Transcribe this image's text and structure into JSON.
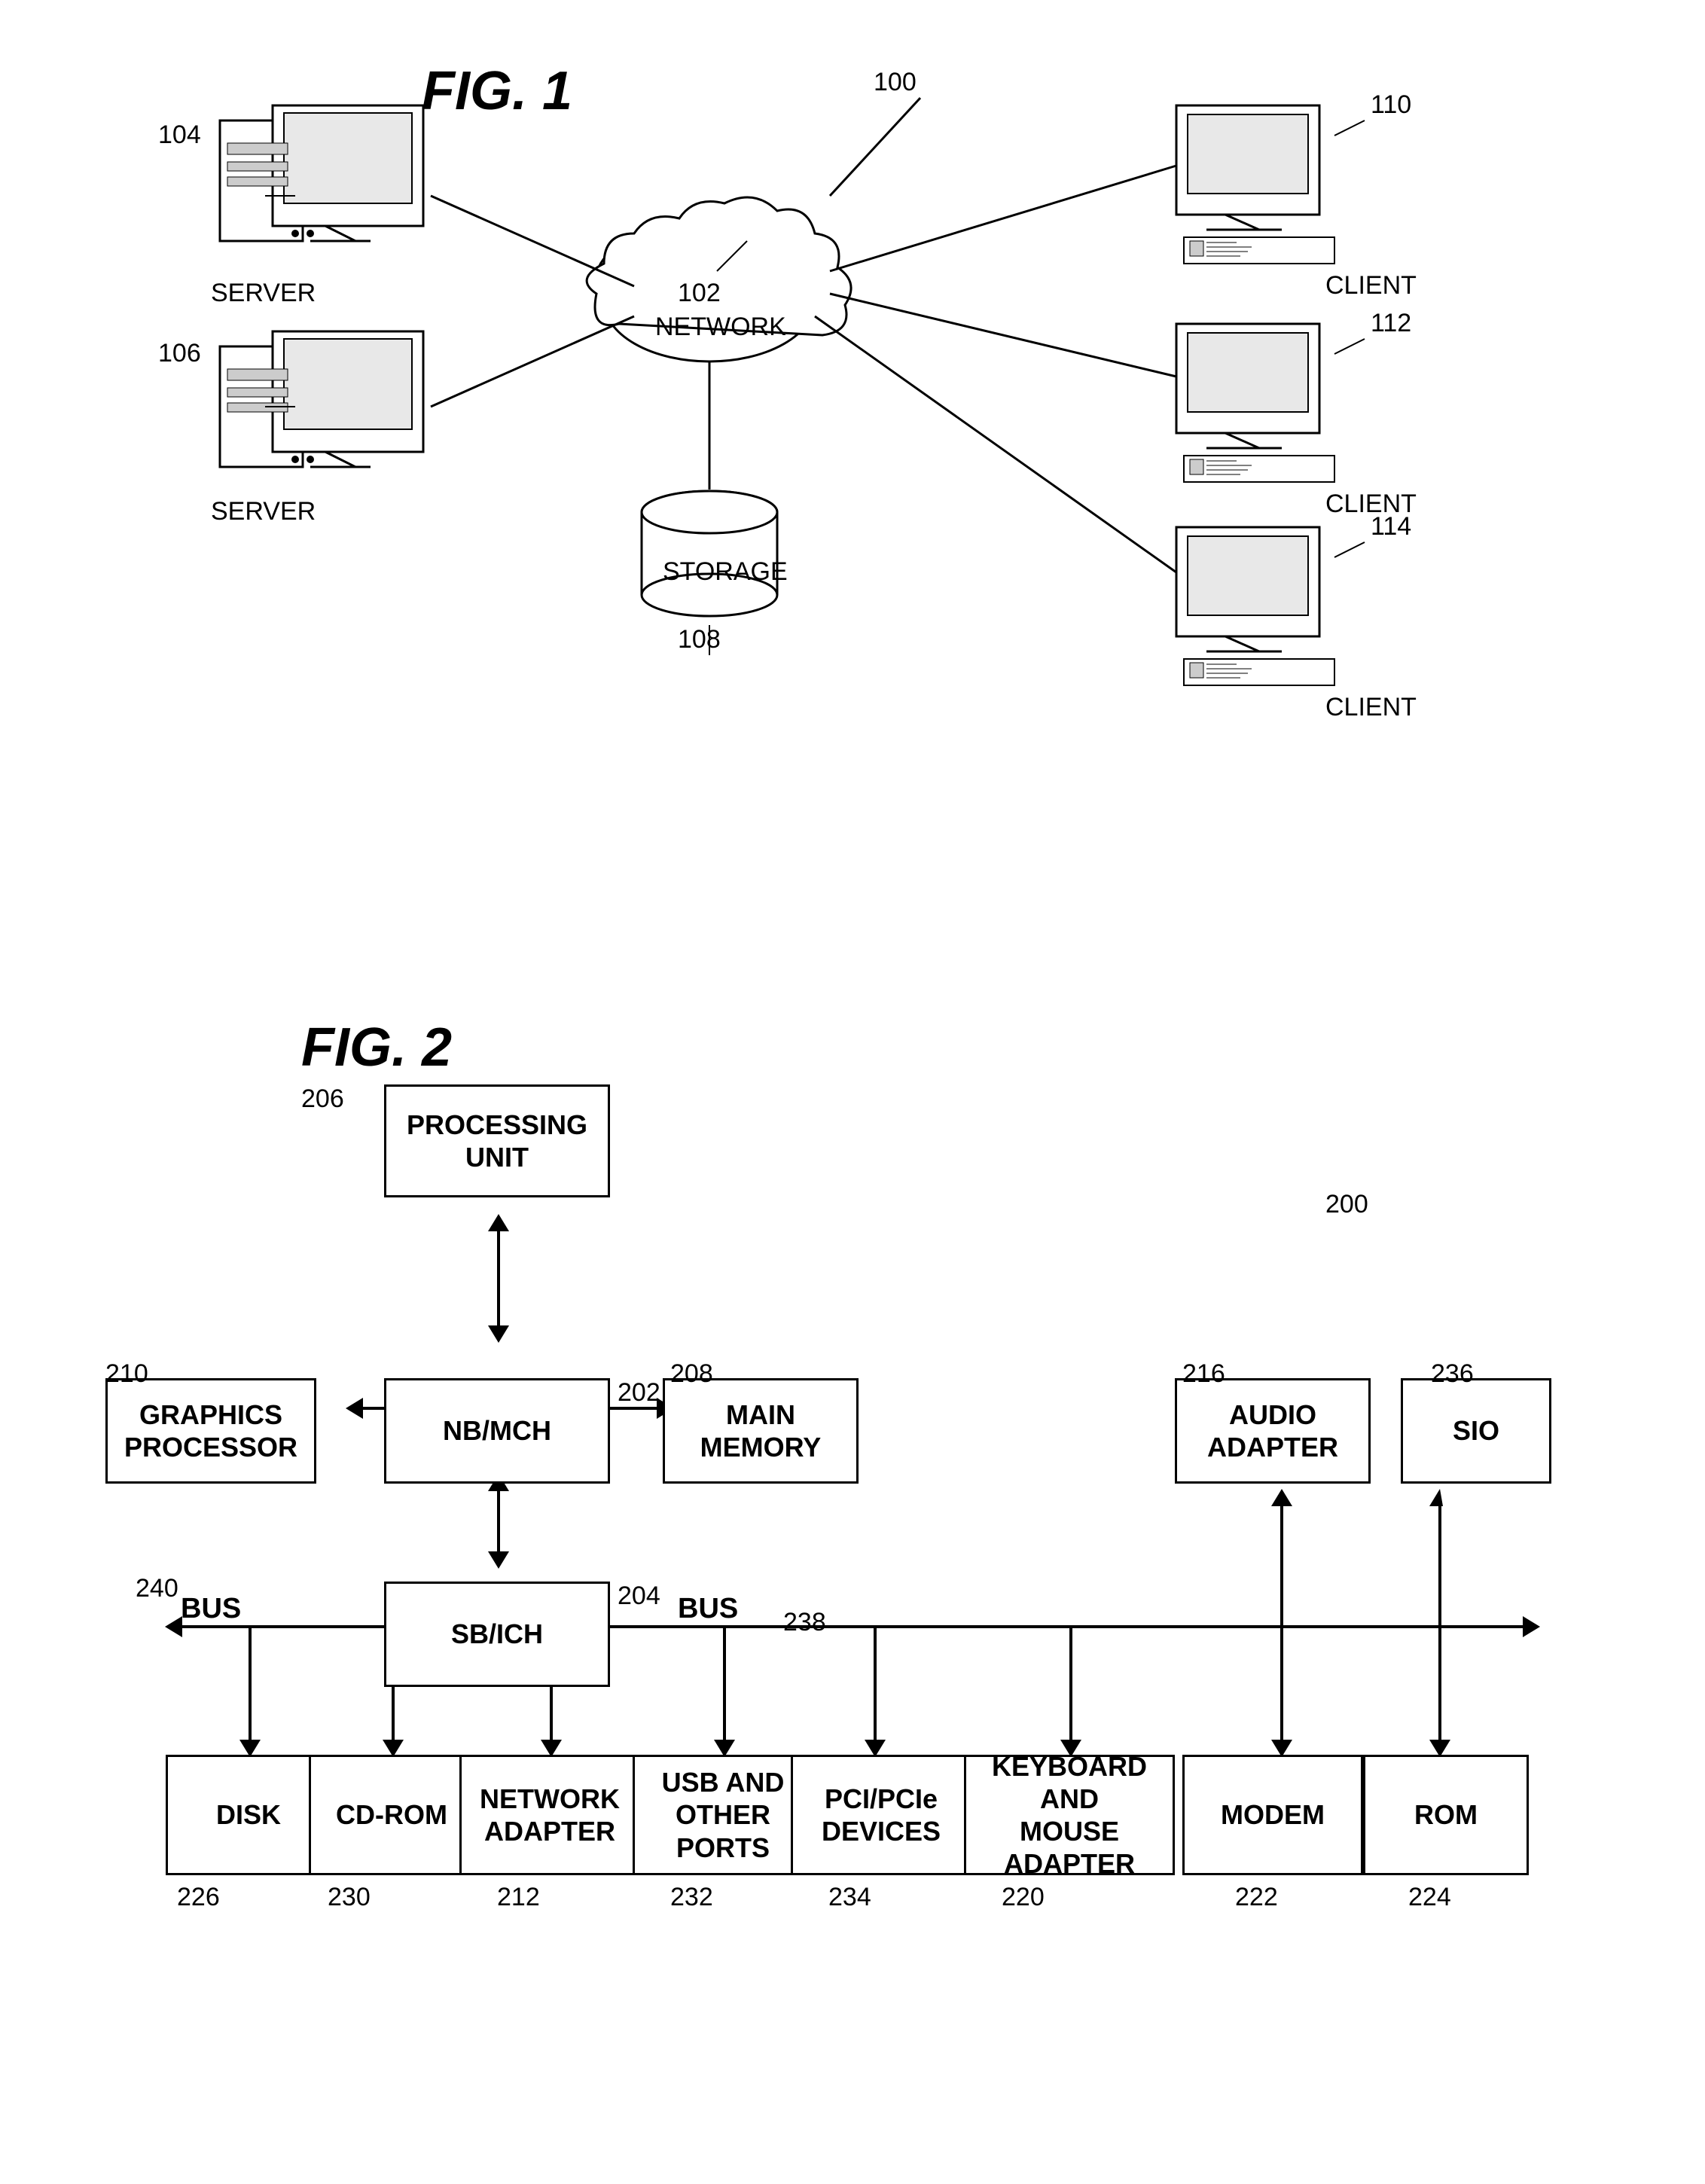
{
  "fig1": {
    "title": "FIG. 1",
    "ref_main": "100",
    "ref_network": "102",
    "ref_server1": "104",
    "ref_server2": "106",
    "ref_storage": "108",
    "ref_client1": "110",
    "ref_client2": "112",
    "ref_client3": "114",
    "label_server": "SERVER",
    "label_network": "NETWORK",
    "label_storage": "STORAGE",
    "label_client": "CLIENT"
  },
  "fig2": {
    "title": "FIG. 2",
    "ref_main": "200",
    "ref_nb_mch": "202",
    "ref_sb_ich": "204",
    "ref_processing_unit": "206",
    "ref_main_memory": "208",
    "ref_graphics": "210",
    "ref_network_adapter": "212",
    "ref_audio": "216",
    "ref_keyboard": "220",
    "ref_modem": "222",
    "ref_rom": "224",
    "ref_disk": "226",
    "ref_cd_rom": "230",
    "ref_usb": "232",
    "ref_pci": "234",
    "ref_sio": "236",
    "ref_bus1": "238",
    "ref_bus2": "240",
    "label_processing_unit": "PROCESSING\nUNIT",
    "label_nb_mch": "NB/MCH",
    "label_sb_ich": "SB/ICH",
    "label_main_memory": "MAIN\nMEMORY",
    "label_graphics": "GRAPHICS\nPROCESSOR",
    "label_network_adapter": "NETWORK\nADAPTER",
    "label_audio": "AUDIO\nADAPTER",
    "label_keyboard": "KEYBOARD\nAND\nMOUSE\nADAPTER",
    "label_modem": "MODEM",
    "label_rom": "ROM",
    "label_disk": "DISK",
    "label_cd_rom": "CD-ROM",
    "label_usb": "USB AND\nOTHER\nPORTS",
    "label_pci": "PCI/PCIe\nDEVICES",
    "label_sio": "SIO",
    "label_bus1": "BUS",
    "label_bus2": "BUS"
  }
}
